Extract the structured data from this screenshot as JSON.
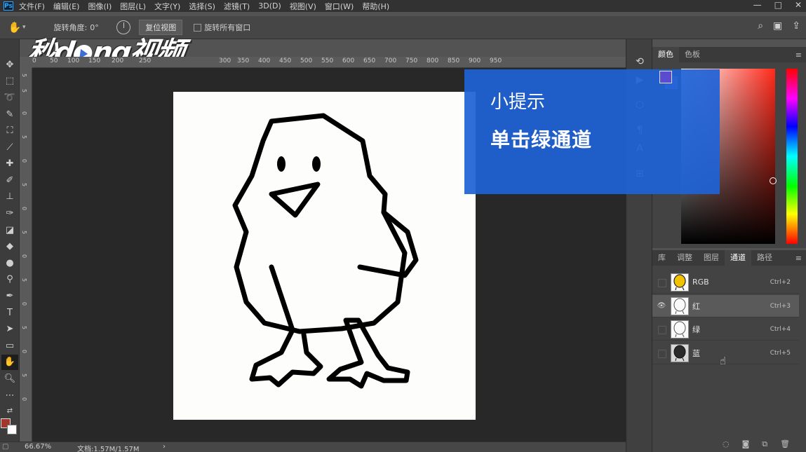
{
  "menubar": {
    "logo": "Ps",
    "items": [
      "文件(F)",
      "编辑(E)",
      "图像(I)",
      "图层(L)",
      "文字(Y)",
      "选择(S)",
      "滤镜(T)",
      "3D(D)",
      "视图(V)",
      "窗口(W)",
      "帮助(H)"
    ],
    "window_controls": [
      "—",
      "□",
      "✕"
    ]
  },
  "options": {
    "rotate_angle_label": "旋转角度:",
    "rotate_angle_value": "0°",
    "reset_view": "复位视图",
    "rotate_all_windows": "旋转所有窗口"
  },
  "watermark": {
    "text_a": "秒d",
    "text_b": "ng视频"
  },
  "ruler": {
    "ticks": [
      "0",
      "50",
      "100",
      "150",
      "200",
      "250",
      "300",
      "350",
      "400",
      "450",
      "500",
      "550",
      "600",
      "650",
      "700",
      "750",
      "800",
      "850",
      "900",
      "950"
    ],
    "v_ticks": [
      "5",
      "5",
      "0",
      "5",
      "0",
      "5",
      "0",
      "5",
      "0",
      "5",
      "0",
      "5",
      "0",
      "5",
      "0"
    ]
  },
  "status": {
    "zoom": "66.67%",
    "doc_info": "文档:1.57M/1.57M",
    "arrow": "›"
  },
  "color_panel": {
    "tabs": [
      "颜色",
      "色板"
    ],
    "active_tab": "颜色",
    "foreground": "#5b4bd1",
    "background": "#8f86ee"
  },
  "channels_panel": {
    "tabs": [
      "库",
      "调整",
      "图层",
      "通道",
      "路径"
    ],
    "active_tab": "通道",
    "channels": [
      {
        "name": "RGB",
        "shortcut": "Ctrl+2",
        "visible": false,
        "selected": false,
        "thumb": "color"
      },
      {
        "name": "红",
        "shortcut": "Ctrl+3",
        "visible": true,
        "selected": true,
        "thumb": "light"
      },
      {
        "name": "绿",
        "shortcut": "Ctrl+4",
        "visible": false,
        "selected": false,
        "thumb": "light"
      },
      {
        "name": "蓝",
        "shortcut": "Ctrl+5",
        "visible": false,
        "selected": false,
        "thumb": "dark"
      }
    ]
  },
  "tip": {
    "title": "小提示",
    "body": "单击绿通道"
  },
  "colors": {
    "fg_swatch": "#a0392c",
    "tip_bg": "#1f62d6"
  }
}
